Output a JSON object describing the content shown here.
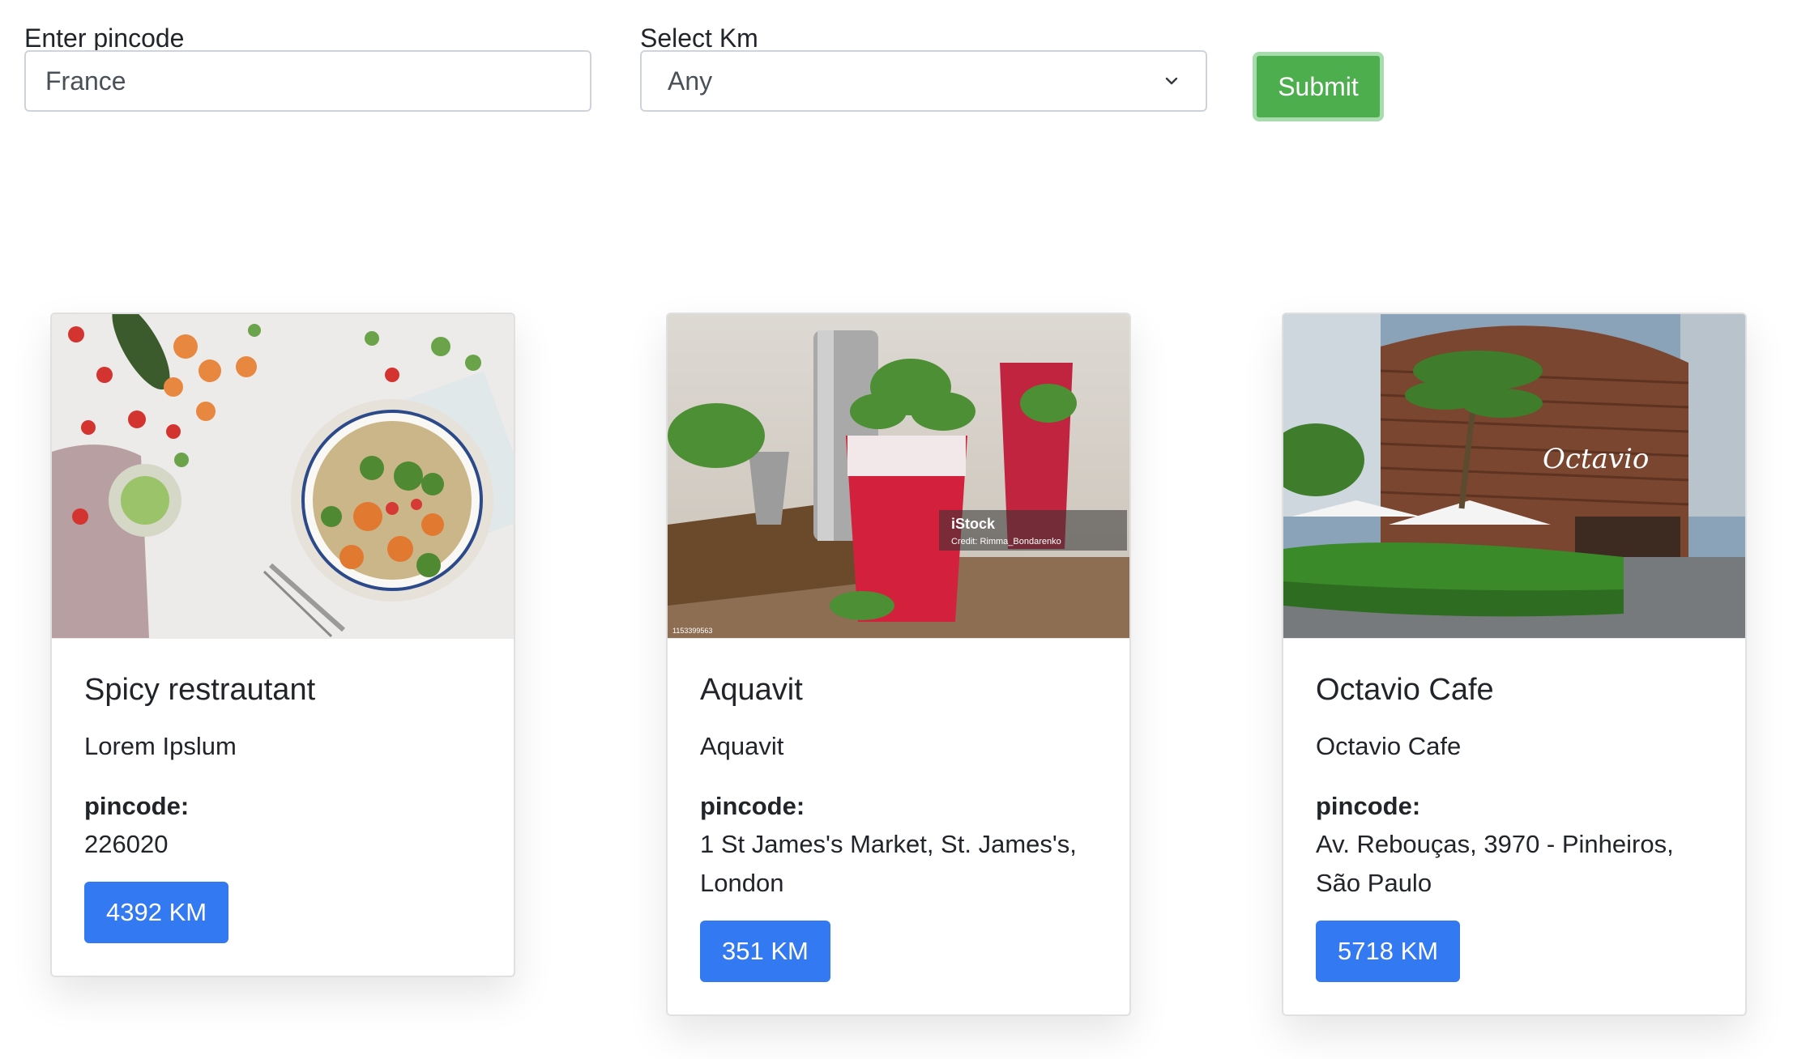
{
  "form": {
    "pincode_label": "Enter pincode",
    "pincode_value": "France",
    "km_label": "Select Km",
    "km_selected": "Any",
    "submit_label": "Submit"
  },
  "cards": [
    {
      "title": "Spicy restrautant",
      "description": "Lorem Ipslum",
      "pincode_label": "pincode:",
      "pincode": "226020",
      "distance": "4392 KM",
      "image_subject": "vegetable bowl"
    },
    {
      "title": "Aquavit",
      "description": "Aquavit",
      "pincode_label": "pincode:",
      "pincode": "1 St James's Market, St. James's, London",
      "distance": "351 KM",
      "image_subject": "red drinks",
      "image_watermark": "iStock",
      "image_credit": "Credit: Rimma_Bondarenko",
      "image_id": "1153399563"
    },
    {
      "title": "Octavio Cafe",
      "description": "Octavio Cafe",
      "pincode_label": "pincode:",
      "pincode": "Av. Rebouças, 3970 - Pinheiros, São Paulo",
      "distance": "5718 KM",
      "image_subject": "cafe building",
      "image_sign": "Octavio"
    }
  ],
  "colors": {
    "submit": "#4cae4c",
    "km_button": "#3379f2",
    "text": "#212529"
  }
}
